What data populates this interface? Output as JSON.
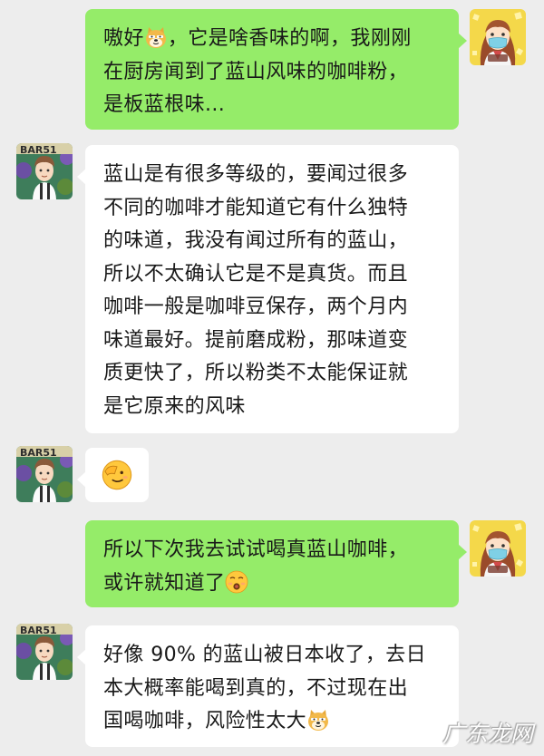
{
  "messages": [
    {
      "side": "right",
      "lines": [
        {
          "before": "嗷好",
          "emoji": "doge-emoji",
          "after": "，它是啥香味的啊，我刚刚"
        },
        {
          "text": "在厨房闻到了蓝山风味的咖啡粉，"
        },
        {
          "text": "是板蓝根味..."
        }
      ]
    },
    {
      "side": "left",
      "lines": [
        "蓝山是有很多等级的，要闻过很多",
        "不同的咖啡才能知道它有什么独特",
        "的味道，我没有闻过所有的蓝山，",
        "所以不太确认它是不是真货。而且",
        "咖啡一般是咖啡豆保存，两个月内",
        "味道最好。提前磨成粉，那味道变",
        "质更快了，所以粉类不太能保证就",
        "是它原来的风味"
      ]
    },
    {
      "side": "left",
      "emoji": "salute-emoji"
    },
    {
      "side": "right",
      "lines": [
        {
          "text": "所以下次我去试试喝真蓝山咖啡，"
        },
        {
          "before": "或许就知道了",
          "emoji": "kiss-emoji",
          "after": ""
        }
      ]
    },
    {
      "side": "left",
      "lines": [
        {
          "text": "好像 90% 的蓝山被日本收了，去日"
        },
        {
          "text": "本大概率能喝到真的，不过现在出"
        },
        {
          "before": "国喝咖啡，风险性太大",
          "emoji": "doge-emoji",
          "after": ""
        }
      ]
    }
  ],
  "watermark": "广东龙网",
  "colors": {
    "background": "#ededed",
    "right_bubble": "#95ec69",
    "left_bubble": "#ffffff"
  }
}
